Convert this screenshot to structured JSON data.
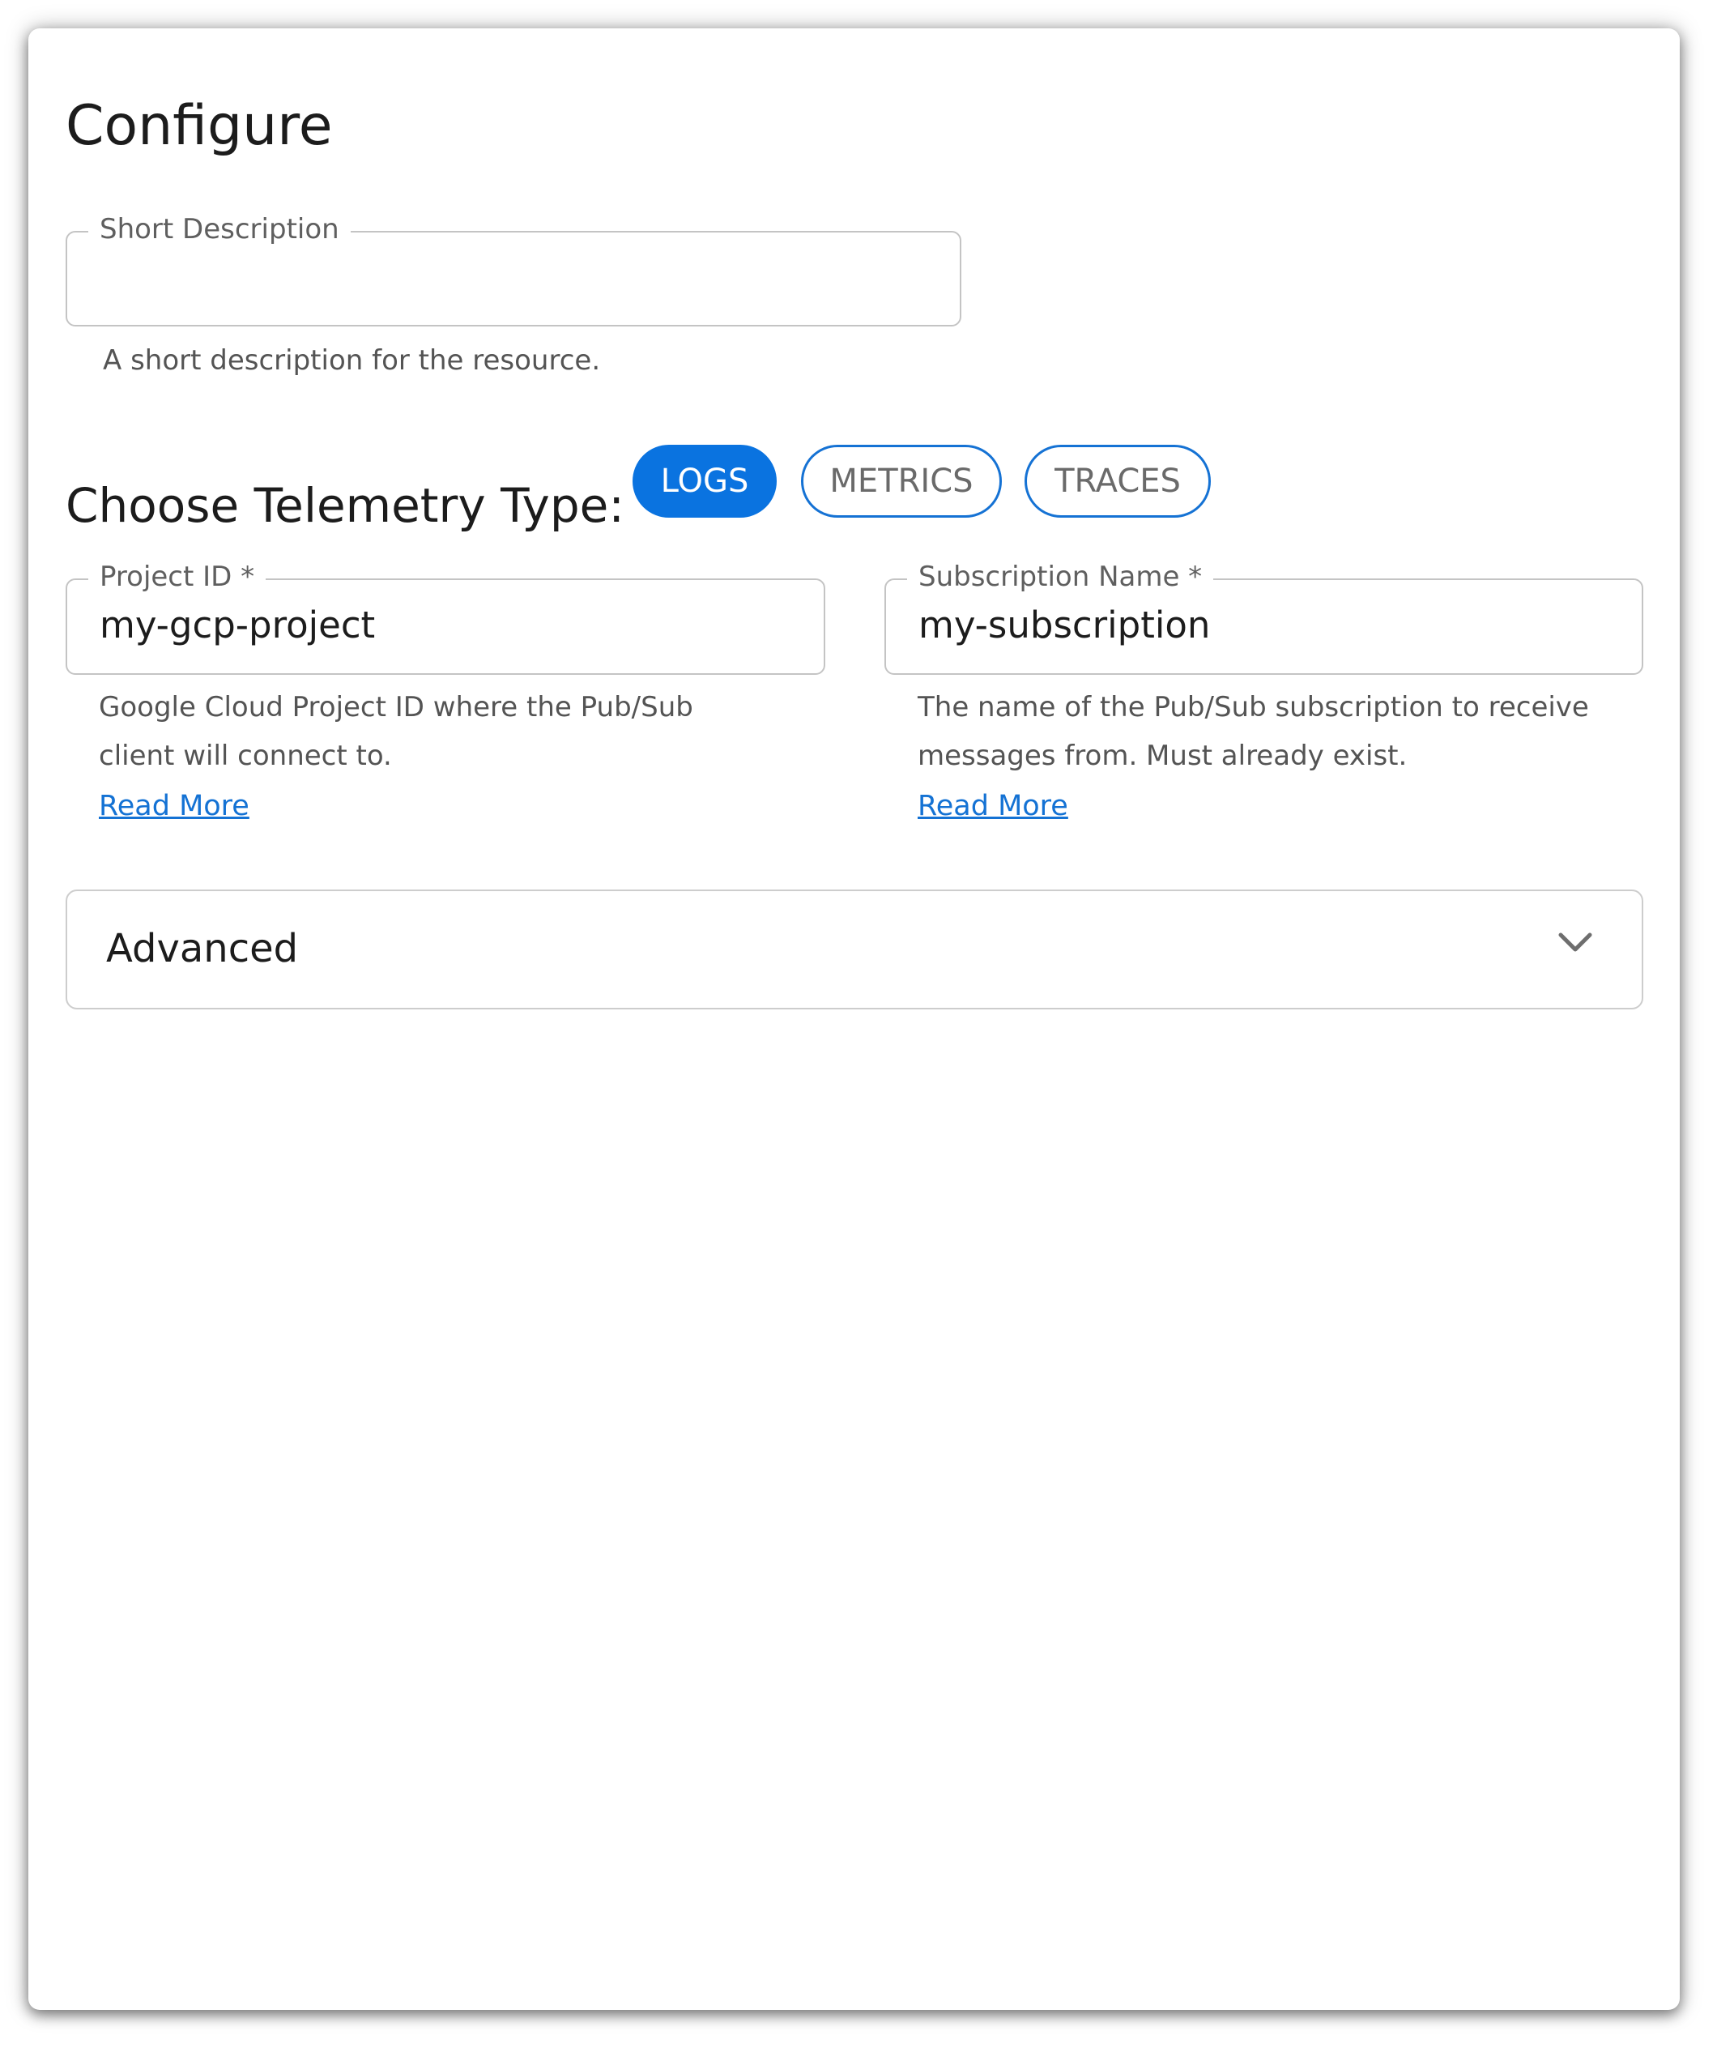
{
  "page": {
    "title": "Configure"
  },
  "short_description": {
    "label": "Short Description",
    "value": "",
    "helper": "A short description for the resource."
  },
  "telemetry": {
    "heading": "Choose Telemetry Type:",
    "options": [
      {
        "label": "LOGS",
        "selected": true
      },
      {
        "label": "METRICS",
        "selected": false
      },
      {
        "label": "TRACES",
        "selected": false
      }
    ]
  },
  "project_id": {
    "label": "Project ID *",
    "value": "my-gcp-project",
    "helper_line1": "Google Cloud Project ID where the Pub/Sub",
    "helper_line2": "client will connect to.",
    "link": "Read More"
  },
  "subscription_name": {
    "label": "Subscription Name *",
    "value": "my-subscription",
    "helper_line1": "The name of the Pub/Sub subscription to receive",
    "helper_line2": "messages from. Must already exist.",
    "link": "Read More"
  },
  "advanced": {
    "label": "Advanced",
    "expanded": false,
    "icon": "chevron-down-icon"
  },
  "colors": {
    "accent": "#0a73e0",
    "link": "#1472d4",
    "border": "#c4c4c4"
  }
}
